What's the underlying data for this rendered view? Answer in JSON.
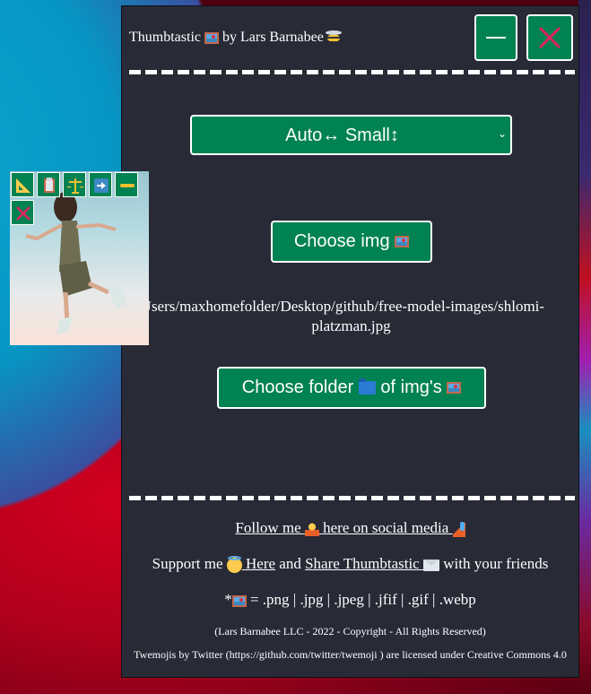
{
  "window": {
    "title_prefix": "Thumbtastic",
    "title_mid": "by Lars Barnabee",
    "title_icons": [
      "framed-picture-icon",
      "bee-icon"
    ],
    "minimize_label": "minimize",
    "close_label": "close"
  },
  "size_select": {
    "selected": "Auto↔ Small↕"
  },
  "buttons": {
    "choose_img": "Choose img",
    "choose_folder_prefix": "Choose folder",
    "choose_folder_suffix": "of img's"
  },
  "selected_path": "/Users/maxhomefolder/Desktop/github/free-model-images/shlomi-platzman.jpg",
  "footer": {
    "follow_prefix": "Follow me ",
    "follow_link": " here on social media ",
    "support_prefix": "Support me",
    "support_link_here": " Here",
    "support_and": " and ",
    "support_link_share": "Share Thumbtastic ",
    "support_suffix": " with your friends",
    "formats_prefix": "*",
    "formats": " = .png | .jpg | .jpeg | .jfif | .gif | .webp",
    "copyright": "(Lars Barnabee LLC - 2022 - Copyright - All Rights Reserved)",
    "credits": "Twemojis by Twitter (https://github.com/twitter/twemoji ) are licensed under Creative Commons 4.0"
  },
  "thumbnail": {
    "tools": [
      {
        "name": "triangular-ruler-icon",
        "label": "measure"
      },
      {
        "name": "clipboard-icon",
        "label": "copy"
      },
      {
        "name": "balance-scale-icon",
        "label": "compare"
      },
      {
        "name": "right-arrow-icon",
        "label": "next"
      },
      {
        "name": "minus-icon",
        "label": "shrink"
      },
      {
        "name": "close-icon",
        "label": "close"
      }
    ]
  },
  "colors": {
    "panel_bg": "#282a36",
    "button_green": "#008252",
    "close_red": "#e0245e",
    "text": "#ffffff"
  }
}
